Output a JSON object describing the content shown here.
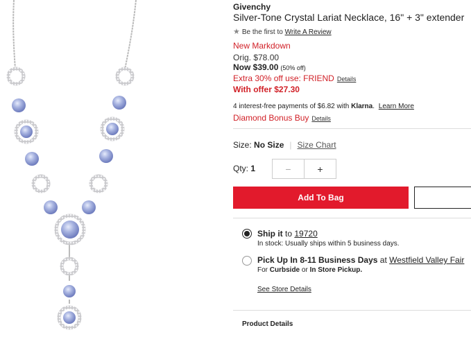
{
  "product": {
    "brand": "Givenchy",
    "title": "Silver-Tone Crystal Lariat Necklace, 16\" + 3\" extender",
    "image_alt": "necklace-image"
  },
  "review": {
    "prefix": "Be the first to",
    "link": "Write A Review",
    "icon": "star-icon"
  },
  "pricing": {
    "markdown_label": "New Markdown",
    "orig": "Orig. $78.00",
    "now": "Now $39.00",
    "now_pct": "(50% off)",
    "extra": "Extra 30% off use: FRIEND",
    "extra_details": "Details",
    "with_offer": "With offer $27.30"
  },
  "financing": {
    "text": "4 interest-free payments of $6.82 with",
    "brand": "Klarna",
    "learn_more": "Learn More"
  },
  "bonus": {
    "label": "Diamond Bonus Buy",
    "details": "Details"
  },
  "size": {
    "label": "Size:",
    "value": "No Size",
    "chart_link": "Size Chart"
  },
  "quantity": {
    "label": "Qty:",
    "value": "1",
    "minus": "−",
    "plus": "+"
  },
  "actions": {
    "add_to_bag": "Add To Bag"
  },
  "fulfillment": {
    "ship_label": "Ship it",
    "ship_to": "to",
    "zip": "19720",
    "ship_sub": "In stock: Usually ships within 5 business days.",
    "pickup_label": "Pick Up In 8-11 Business Days",
    "pickup_at": "at",
    "store": "Westfield Valley Fair",
    "pickup_sub_prefix": "For",
    "curbside": "Curbside",
    "or": "or",
    "in_store": "In Store Pickup.",
    "see_store": "See Store Details"
  },
  "sections": {
    "product_details": "Product Details"
  },
  "colors": {
    "accent_red": "#e21a2c",
    "sale_red": "#d12027"
  }
}
